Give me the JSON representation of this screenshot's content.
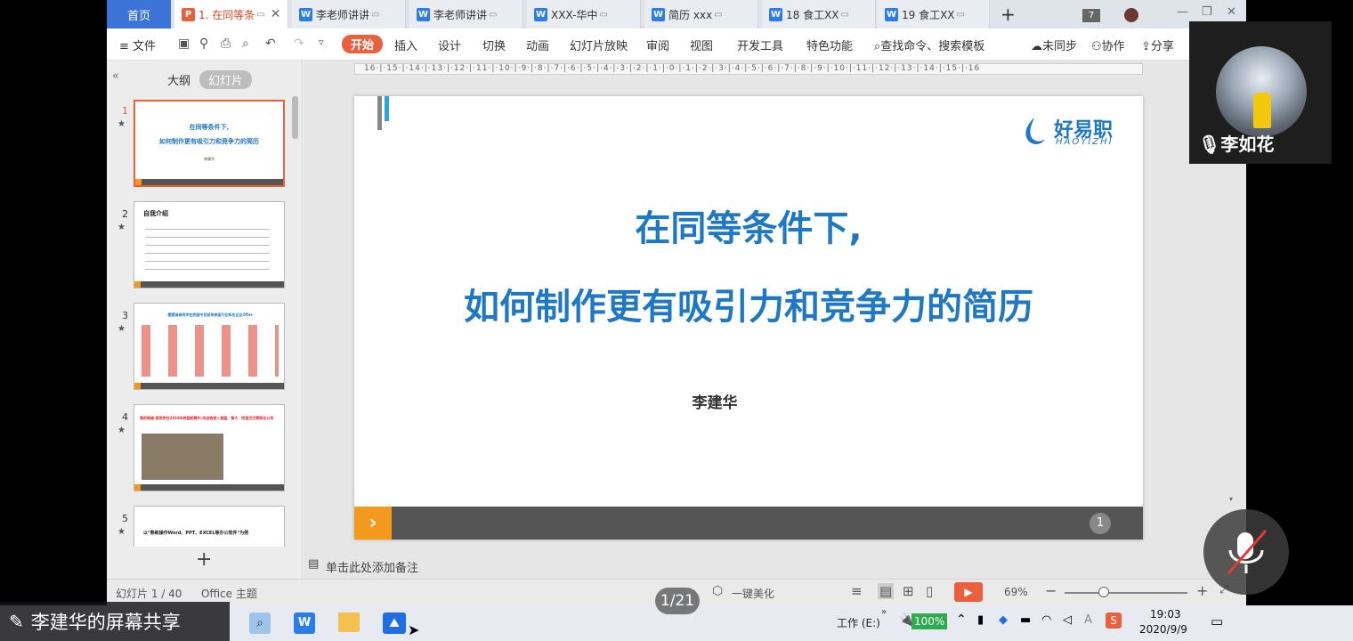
{
  "tabs": {
    "home": "首页",
    "docs": [
      {
        "label": "1. 在同等条",
        "type": "P"
      },
      {
        "label": "李老师讲讲",
        "type": "W"
      },
      {
        "label": "李老师讲讲",
        "type": "W"
      },
      {
        "label": "XXX-华中",
        "type": "W"
      },
      {
        "label": "简历  xxx",
        "type": "W"
      },
      {
        "label": "18 食工XX",
        "type": "W"
      },
      {
        "label": "19 食工XX",
        "type": "W"
      }
    ],
    "count_badge": "7"
  },
  "menu": {
    "file": "≡ 文件",
    "items": [
      "开始",
      "插入",
      "设计",
      "切换",
      "动画",
      "幻灯片放映",
      "审阅",
      "视图",
      "开发工具",
      "特色功能"
    ],
    "search": "查找命令、搜索模板",
    "sync": "未同步",
    "collab": "协作",
    "share": "分享"
  },
  "panel": {
    "collapse": "«",
    "tab_outline": "大纲",
    "tab_slides": "幻灯片",
    "add": "+",
    "thumbs": [
      {
        "num": "1",
        "line1": "在同等条件下,",
        "line2": "如何制作更有吸引力和竞争力的简历",
        "line3": "李建华"
      },
      {
        "num": "2",
        "heading": "自我介绍"
      },
      {
        "num": "3",
        "heading": "摆摆谁参同学在校园中目前录参面行业知名企业Offer"
      },
      {
        "num": "4",
        "heading": "我的网络-某同学在2018年校园招聘中,均自统进入首届、第大、阿里巴巴等知名公司"
      },
      {
        "num": "5",
        "heading": "以\"熟练操作Word、PPT、EXCEL等办公软件\"为例"
      }
    ]
  },
  "ruler": "16·|·15·|·14·|·13·|·12·|·11·|·10·|·9·|·8·|·7·|·6·|·5·|·4·|·3·|·2·|·1·|·0·|·1·|·2·|·3·|·4·|·5·|·6·|·7·|·8·|·9·|·10·|·11·|·12·|·13·|·14·|·15·|·16",
  "slide": {
    "logo_cn": "好易职",
    "logo_en": "HAOYIZHI",
    "title_line1": "在同等条件下,",
    "title_line2": "如何制作更有吸引力和竞争力的简历",
    "author": "李建华",
    "page": "1"
  },
  "notes_placeholder": "单击此处添加备注",
  "status": {
    "slide_count": "幻灯片 1 / 40",
    "theme": "Office 主题",
    "beautify": "一键美化",
    "zoom": "69%"
  },
  "page_indicator": "1/21",
  "share_label": "李建华的屏幕共享",
  "video": {
    "name": "李如花"
  },
  "taskbar": {
    "workspace": "工作 (E:)",
    "battery": "100%",
    "time": "19:03",
    "date": "2020/9/9"
  },
  "colors": {
    "accent": "#e8603c",
    "title": "#1e78c3",
    "orange": "#f39a1e"
  }
}
